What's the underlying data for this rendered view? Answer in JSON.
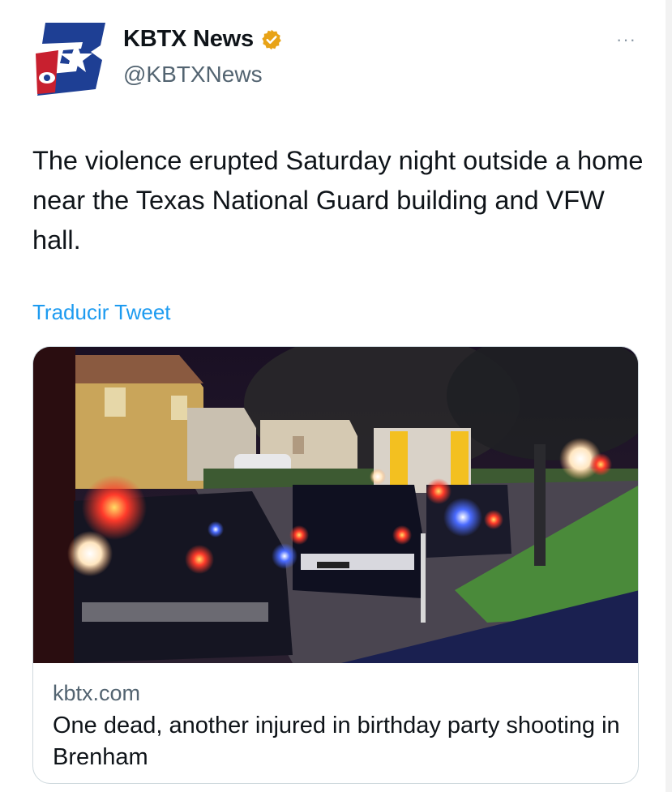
{
  "author": {
    "display_name": "KBTX News",
    "handle": "@KBTXNews",
    "avatar_icon": "kbtx-cbs-logo-icon",
    "verified_icon": "verified-badge-icon",
    "verified_color": "#e8a317"
  },
  "more_icon": "more-options-icon",
  "more_label": "···",
  "tweet": {
    "text": "The violence erupted Saturday night outside a home near the Texas National Guard building and VFW hall.",
    "translate_label": "Traducir Tweet"
  },
  "link_card": {
    "image_description_icon": "news-photo-police-scene",
    "domain": "kbtx.com",
    "title": "One dead, another injured in birthday party shooting in Brenham"
  },
  "colors": {
    "link_blue": "#1d9bf0",
    "secondary_text": "#536471",
    "primary_text": "#0f1419",
    "border": "#cfd9de"
  }
}
